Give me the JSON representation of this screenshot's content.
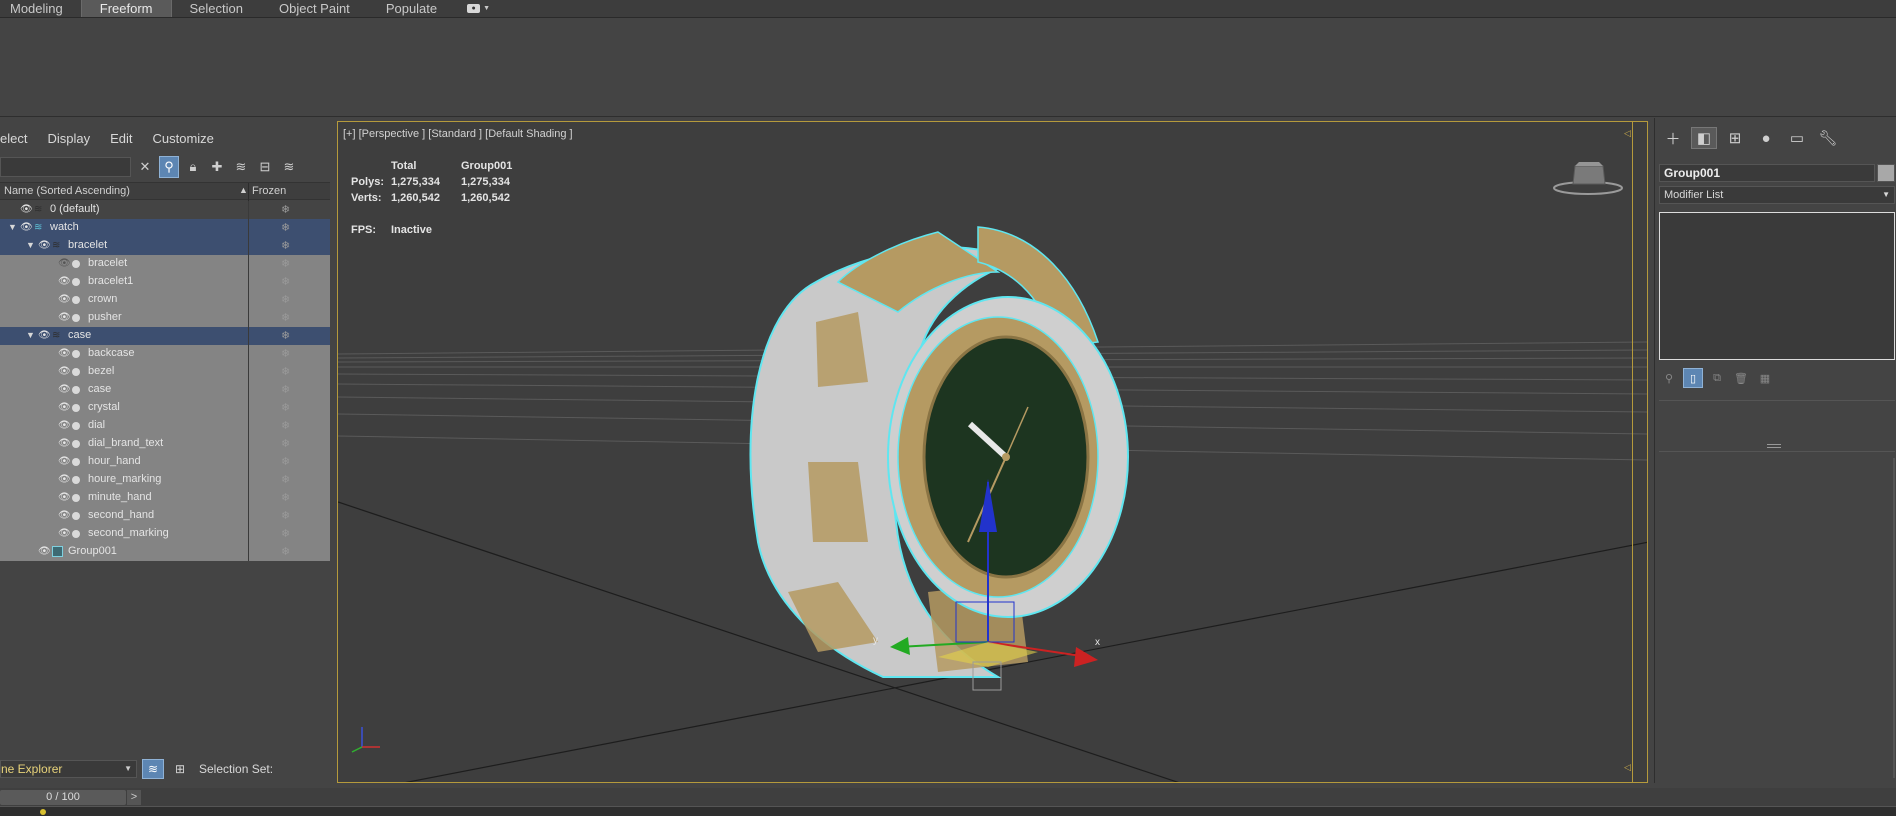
{
  "ribbon": {
    "tabs": [
      {
        "label": "Modeling",
        "active": false
      },
      {
        "label": "Freeform",
        "active": true
      },
      {
        "label": "Selection",
        "active": false
      },
      {
        "label": "Object Paint",
        "active": false
      },
      {
        "label": "Populate",
        "active": false
      }
    ]
  },
  "scene_explorer": {
    "menu": [
      "elect",
      "Display",
      "Edit",
      "Customize"
    ],
    "header": {
      "name": "Name (Sorted Ascending)",
      "frozen": "Frozen"
    },
    "rows": [
      {
        "label": "0 (default)",
        "level": 0,
        "kind": "layer",
        "state": "plain"
      },
      {
        "label": "watch",
        "level": 0,
        "kind": "layer",
        "state": "sel",
        "expanded": true
      },
      {
        "label": "bracelet",
        "level": 1,
        "kind": "layer",
        "state": "sel",
        "expanded": true
      },
      {
        "label": "bracelet",
        "level": 2,
        "kind": "object",
        "state": "child",
        "hidden": true
      },
      {
        "label": "bracelet1",
        "level": 2,
        "kind": "object",
        "state": "child"
      },
      {
        "label": "crown",
        "level": 2,
        "kind": "object",
        "state": "child"
      },
      {
        "label": "pusher",
        "level": 2,
        "kind": "object",
        "state": "child"
      },
      {
        "label": "case",
        "level": 1,
        "kind": "layer",
        "state": "sel",
        "expanded": true
      },
      {
        "label": "backcase",
        "level": 2,
        "kind": "object",
        "state": "child"
      },
      {
        "label": "bezel",
        "level": 2,
        "kind": "object",
        "state": "child"
      },
      {
        "label": "case",
        "level": 2,
        "kind": "object",
        "state": "child"
      },
      {
        "label": "crystal",
        "level": 2,
        "kind": "object",
        "state": "child"
      },
      {
        "label": "dial",
        "level": 2,
        "kind": "object",
        "state": "child"
      },
      {
        "label": "dial_brand_text",
        "level": 2,
        "kind": "object",
        "state": "child"
      },
      {
        "label": "hour_hand",
        "level": 2,
        "kind": "object",
        "state": "child"
      },
      {
        "label": "houre_marking",
        "level": 2,
        "kind": "object",
        "state": "child"
      },
      {
        "label": "minute_hand",
        "level": 2,
        "kind": "object",
        "state": "child"
      },
      {
        "label": "second_hand",
        "level": 2,
        "kind": "object",
        "state": "child"
      },
      {
        "label": "second_marking",
        "level": 2,
        "kind": "object",
        "state": "child"
      },
      {
        "label": "Group001",
        "level": 1,
        "kind": "group",
        "state": "child"
      }
    ],
    "explorer_name": "ne Explorer",
    "selection_set_label": "Selection Set:"
  },
  "viewport": {
    "label": "[+] [Perspective ] [Standard ] [Default Shading ]",
    "stats": {
      "col_total": "Total",
      "col_group": "Group001",
      "polys_label": "Polys:",
      "polys_total": "1,275,334",
      "polys_group": "1,275,334",
      "verts_label": "Verts:",
      "verts_total": "1,260,542",
      "verts_group": "1,260,542"
    },
    "fps_label": "FPS:",
    "fps_value": "Inactive",
    "gizmo_x": "x",
    "gizmo_y": "y"
  },
  "command_panel": {
    "object_name": "Group001",
    "modifier_list": "Modifier List"
  },
  "timeline": {
    "frame": "0 / 100",
    "next": ">"
  },
  "colors": {
    "selection_highlight": "#3d4f70",
    "viewport_border": "#b59a3c",
    "outline": "#5fe6f0",
    "gold": "#b59a62",
    "silver": "#c8c8c8",
    "dial": "#1d3520"
  }
}
